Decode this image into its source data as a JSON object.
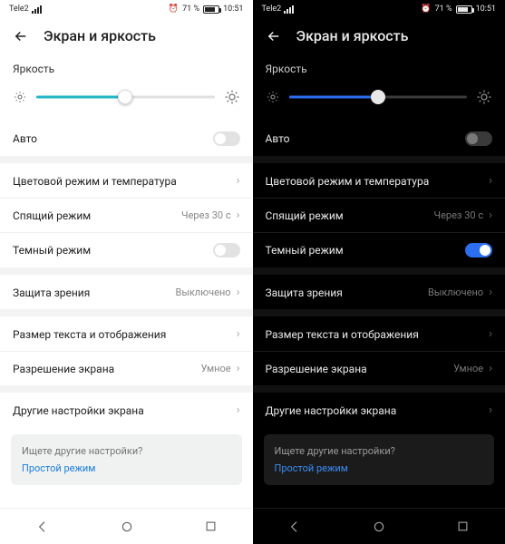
{
  "status": {
    "carrier": "Tele2",
    "battery_pct": "71 %",
    "time": "10:51",
    "battery_fill_pct": 71
  },
  "header": {
    "title": "Экран и яркость"
  },
  "brightness": {
    "label": "Яркость",
    "value_pct": 50
  },
  "rows": {
    "auto": "Авто",
    "color": "Цветовой режим и температура",
    "sleep": "Спящий режим",
    "sleep_value": "Через 30 с",
    "dark": "Темный режим",
    "eye": "Защита зрения",
    "eye_value": "Выключено",
    "textsize": "Размер текста и отображения",
    "resolution": "Разрешение экрана",
    "resolution_value": "Умное",
    "other": "Другие настройки экрана"
  },
  "card": {
    "question": "Ищете другие настройки?",
    "link": "Простой режим"
  }
}
